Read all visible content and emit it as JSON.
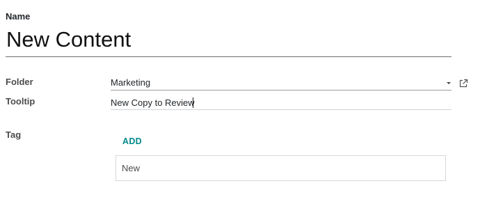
{
  "form": {
    "name_label": "Name",
    "name_value": "New Content",
    "folder_label": "Folder",
    "folder_value": "Marketing",
    "tooltip_label": "Tooltip",
    "tooltip_value": "New Copy to Review",
    "tag_label": "Tag",
    "tag_add_label": "ADD",
    "tags": [
      "New"
    ]
  },
  "icons": {
    "folder_dropdown": "chevron-down-icon",
    "folder_open": "external-link-icon"
  },
  "colors": {
    "accent": "#01898c",
    "text": "#212529",
    "label": "#4c4c4c",
    "border": "#d7d7d7"
  }
}
